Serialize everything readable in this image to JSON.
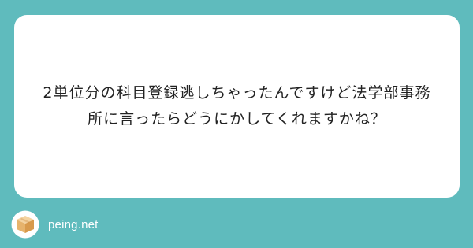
{
  "question": {
    "text": "2単位分の科目登録逃しちゃったんですけど法学部事務所に言ったらどうにかしてくれますかね？"
  },
  "footer": {
    "brand_text": "peing.net",
    "logo_icon": "cardboard-box-icon"
  },
  "colors": {
    "background": "#5fbbbd",
    "card": "#ffffff",
    "text": "#222222",
    "brand_text": "#ffffff",
    "logo_box": "#e6b36c"
  }
}
